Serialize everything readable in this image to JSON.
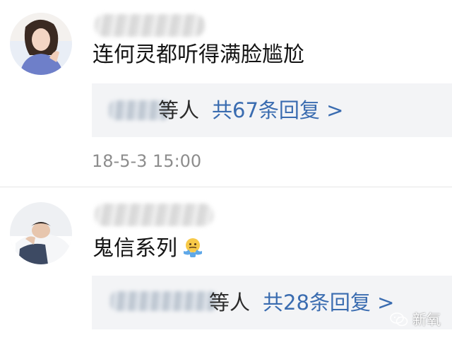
{
  "comments": [
    {
      "avatar_icon": "user-avatar-woman",
      "text": "连何灵都听得满脸尴尬",
      "replies": {
        "who_label": "等人",
        "count_label": "共67条回复 >"
      },
      "timestamp": "18-5-3 15:00"
    },
    {
      "avatar_icon": "user-avatar-sleeping",
      "text": "鬼信系列",
      "emoji_icon": "shrug-emoji-icon",
      "replies": {
        "who_label": "等人",
        "count_label": "共28条回复 >"
      }
    }
  ],
  "colors": {
    "reply_link": "#3a6cb0",
    "reply_bg": "#f3f4f6",
    "timestamp": "#8d8d8d"
  },
  "watermark": {
    "icon": "wechat-icon",
    "text": "新氧"
  }
}
